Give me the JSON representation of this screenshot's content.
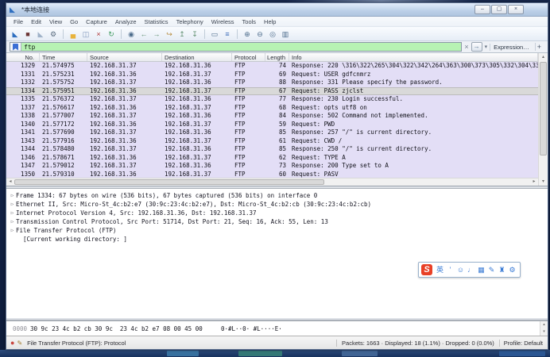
{
  "window": {
    "title": "*本地连接",
    "controls": {
      "minimize": "–",
      "maximize": "▢",
      "close": "×"
    }
  },
  "menu": {
    "items": [
      "File",
      "Edit",
      "View",
      "Go",
      "Capture",
      "Analyze",
      "Statistics",
      "Telephony",
      "Wireless",
      "Tools",
      "Help"
    ]
  },
  "toolbar": {
    "icons": [
      {
        "name": "start-capture-icon",
        "glyph": "◣",
        "color": "#2e6fc0"
      },
      {
        "name": "stop-capture-icon",
        "glyph": "■",
        "color": "#6b3434"
      },
      {
        "name": "restart-capture-icon",
        "glyph": "◣",
        "color": "#9fb2c8"
      },
      {
        "name": "capture-options-icon",
        "glyph": "⚙",
        "color": "#5a6d80"
      },
      {
        "sep": true
      },
      {
        "name": "open-file-icon",
        "glyph": "▄",
        "color": "#e8b33c"
      },
      {
        "name": "save-file-icon",
        "glyph": "◫",
        "color": "#7c93b8"
      },
      {
        "name": "close-file-icon",
        "glyph": "×",
        "color": "#b03a3a"
      },
      {
        "name": "reload-icon",
        "glyph": "↻",
        "color": "#3f9a5f"
      },
      {
        "sep": true
      },
      {
        "name": "find-packet-icon",
        "glyph": "◉",
        "color": "#4a6a8a"
      },
      {
        "name": "go-back-icon",
        "glyph": "←",
        "color": "#5f8f6f"
      },
      {
        "name": "go-forward-icon",
        "glyph": "→",
        "color": "#5f8f6f"
      },
      {
        "name": "go-to-packet-icon",
        "glyph": "↪",
        "color": "#b58a3a"
      },
      {
        "name": "go-first-icon",
        "glyph": "↥",
        "color": "#5f8f6f"
      },
      {
        "name": "go-last-icon",
        "glyph": "↧",
        "color": "#5f8f6f"
      },
      {
        "sep": true
      },
      {
        "name": "autoscroll-icon",
        "glyph": "▭",
        "color": "#4a6a8a"
      },
      {
        "name": "colorize-icon",
        "glyph": "≡",
        "color": "#3a6ab8"
      },
      {
        "sep": true
      },
      {
        "name": "zoom-in-icon",
        "glyph": "⊕",
        "color": "#4a6a8a"
      },
      {
        "name": "zoom-out-icon",
        "glyph": "⊖",
        "color": "#4a6a8a"
      },
      {
        "name": "zoom-reset-icon",
        "glyph": "◎",
        "color": "#4a6a8a"
      },
      {
        "name": "resize-columns-icon",
        "glyph": "▥",
        "color": "#4a6a8a"
      }
    ]
  },
  "filter": {
    "value": "ftp",
    "clear_glyph": "×",
    "apply_glyph": "→",
    "dropdown_glyph": "▾",
    "expression_label": "Expression…",
    "add_label": "+"
  },
  "packet_list": {
    "columns": [
      {
        "key": "no",
        "label": "No."
      },
      {
        "key": "time",
        "label": "Time"
      },
      {
        "key": "source",
        "label": "Source"
      },
      {
        "key": "destination",
        "label": "Destination"
      },
      {
        "key": "protocol",
        "label": "Protocol"
      },
      {
        "key": "length",
        "label": "Length"
      },
      {
        "key": "info",
        "label": "Info"
      }
    ],
    "rows": [
      {
        "no": "1329",
        "time": "21.574975",
        "source": "192.168.31.37",
        "destination": "192.168.31.36",
        "protocol": "FTP",
        "length": "74",
        "info": "Response: 220 \\316\\322\\265\\304\\322\\342\\264\\363\\300\\373\\305\\332\\304\\330"
      },
      {
        "no": "1331",
        "time": "21.575231",
        "source": "192.168.31.36",
        "destination": "192.168.31.37",
        "protocol": "FTP",
        "length": "69",
        "info": "Request: USER gdfcnmrz"
      },
      {
        "no": "1332",
        "time": "21.575752",
        "source": "192.168.31.37",
        "destination": "192.168.31.36",
        "protocol": "FTP",
        "length": "88",
        "info": "Response: 331 Please specify the password."
      },
      {
        "no": "1334",
        "time": "21.575951",
        "source": "192.168.31.36",
        "destination": "192.168.31.37",
        "protocol": "FTP",
        "length": "67",
        "info": "Request: PASS zjclst",
        "selected": true
      },
      {
        "no": "1335",
        "time": "21.576372",
        "source": "192.168.31.37",
        "destination": "192.168.31.36",
        "protocol": "FTP",
        "length": "77",
        "info": "Response: 230 Login successful."
      },
      {
        "no": "1337",
        "time": "21.576617",
        "source": "192.168.31.36",
        "destination": "192.168.31.37",
        "protocol": "FTP",
        "length": "68",
        "info": "Request: opts utf8 on"
      },
      {
        "no": "1338",
        "time": "21.577007",
        "source": "192.168.31.37",
        "destination": "192.168.31.36",
        "protocol": "FTP",
        "length": "84",
        "info": "Response: 502 Command not implemented."
      },
      {
        "no": "1340",
        "time": "21.577172",
        "source": "192.168.31.36",
        "destination": "192.168.31.37",
        "protocol": "FTP",
        "length": "59",
        "info": "Request: PWD"
      },
      {
        "no": "1341",
        "time": "21.577690",
        "source": "192.168.31.37",
        "destination": "192.168.31.36",
        "protocol": "FTP",
        "length": "85",
        "info": "Response: 257 \"/\" is current directory."
      },
      {
        "no": "1343",
        "time": "21.577916",
        "source": "192.168.31.36",
        "destination": "192.168.31.37",
        "protocol": "FTP",
        "length": "61",
        "info": "Request: CWD /"
      },
      {
        "no": "1344",
        "time": "21.578480",
        "source": "192.168.31.37",
        "destination": "192.168.31.36",
        "protocol": "FTP",
        "length": "85",
        "info": "Response: 250 \"/\" is current directory."
      },
      {
        "no": "1346",
        "time": "21.578671",
        "source": "192.168.31.36",
        "destination": "192.168.31.37",
        "protocol": "FTP",
        "length": "62",
        "info": "Request: TYPE A"
      },
      {
        "no": "1347",
        "time": "21.579012",
        "source": "192.168.31.37",
        "destination": "192.168.31.36",
        "protocol": "FTP",
        "length": "73",
        "info": "Response: 200 Type set to A"
      },
      {
        "no": "1350",
        "time": "21.579310",
        "source": "192.168.31.36",
        "destination": "192.168.31.37",
        "protocol": "FTP",
        "length": "60",
        "info": "Request: PASV"
      }
    ]
  },
  "details": {
    "lines": [
      {
        "expander": "▷",
        "text": "Frame 1334: 67 bytes on wire (536 bits), 67 bytes captured (536 bits) on interface 0"
      },
      {
        "expander": "▷",
        "text": "Ethernet II, Src: Micro-St_4c:b2:e7 (30:9c:23:4c:b2:e7), Dst: Micro-St_4c:b2:cb (30:9c:23:4c:b2:cb)"
      },
      {
        "expander": "▷",
        "text": "Internet Protocol Version 4, Src: 192.168.31.36, Dst: 192.168.31.37"
      },
      {
        "expander": "▷",
        "text": "Transmission Control Protocol, Src Port: 51714, Dst Port: 21, Seq: 16, Ack: 55, Len: 13"
      },
      {
        "expander": "▷",
        "text": "File Transfer Protocol (FTP)"
      },
      {
        "expander": "",
        "text": "[Current working directory: ]",
        "indent": true
      }
    ]
  },
  "sogou": {
    "logo": "S",
    "icons": [
      {
        "name": "sogou-english-mode-icon",
        "glyph": "英"
      },
      {
        "name": "sogou-punctuation-icon",
        "glyph": "’"
      },
      {
        "name": "sogou-emoji-icon",
        "glyph": "☺"
      },
      {
        "name": "sogou-voice-icon",
        "glyph": "♩"
      },
      {
        "name": "sogou-keyboard-icon",
        "glyph": "▦"
      },
      {
        "name": "sogou-handwriting-icon",
        "glyph": "✎"
      },
      {
        "name": "sogou-skin-icon",
        "glyph": "♜"
      },
      {
        "name": "sogou-wrench-icon",
        "glyph": "⚙"
      }
    ]
  },
  "hex": {
    "offset": "0000",
    "bytes": "30 9c 23 4c b2 cb 30 9c  23 4c b2 e7 08 00 45 00",
    "ascii": "0·#L··0· #L····E·"
  },
  "status_bar": {
    "help_text": "File Transfer Protocol (FTP): Protocol",
    "packets": "Packets: 1663 · Displayed: 18 (1.1%) · Dropped: 0 (0.0%)",
    "profile": "Profile: Default"
  },
  "colors": {
    "filter-bg": "#b7f2b3",
    "row-bg": "#e3def6",
    "selected-bg": "#d9d9d9",
    "sogou-red": "#e84026",
    "status-red": "#c8453f"
  }
}
